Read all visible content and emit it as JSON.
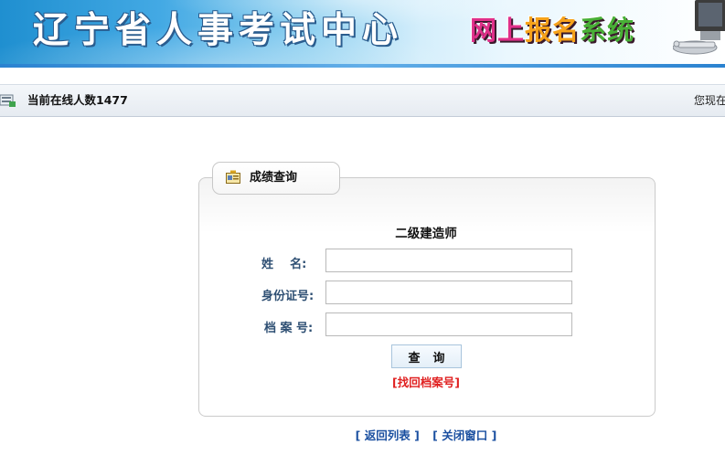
{
  "header": {
    "site_title": "辽宁省人事考试中心",
    "system_title_chars": [
      "网",
      "上",
      "报",
      "名",
      "系",
      "统"
    ],
    "brand_colors": {
      "banner_blue": "#1f8fd0",
      "system_title_pink": "#e0308a",
      "system_title_orange": "#f6a21a",
      "system_title_green": "#48b036"
    }
  },
  "status": {
    "online_label": "当前在线人数1477",
    "welcome_text": "您现在"
  },
  "panel": {
    "tab_title": "成绩查询",
    "exam_name": "二级建造师",
    "fields": [
      {
        "label": "姓    名:",
        "value": "",
        "placeholder": ""
      },
      {
        "label": "身份证号:",
        "value": "",
        "placeholder": ""
      },
      {
        "label": "档 案 号:",
        "value": "",
        "placeholder": ""
      }
    ],
    "query_button": "查询",
    "find_archive_link": "[找回档案号]"
  },
  "footer": {
    "back_link": "[ 返回列表 ]",
    "close_link": "[ 关闭窗口 ]"
  },
  "icons": [
    "status-bar-icon",
    "certificate-icon",
    "computer-icon"
  ]
}
